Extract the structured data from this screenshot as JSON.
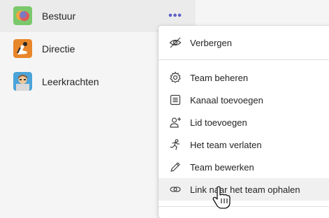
{
  "teams": [
    {
      "name": "Bestuur",
      "avatar_icon": "chat-bubbles-avatar-icon"
    },
    {
      "name": "Directie",
      "avatar_icon": "diver-avatar-icon"
    },
    {
      "name": "Leerkrachten",
      "avatar_icon": "teacher-avatar-icon"
    }
  ],
  "more_options_glyph": "•••",
  "context_menu": {
    "items": [
      {
        "label": "Verbergen",
        "icon": "eye-off-icon"
      },
      {
        "label": "Team beheren",
        "icon": "gear-icon"
      },
      {
        "label": "Kanaal toevoegen",
        "icon": "channel-add-icon"
      },
      {
        "label": "Lid toevoegen",
        "icon": "person-add-icon"
      },
      {
        "label": "Het team verlaten",
        "icon": "running-person-icon"
      },
      {
        "label": "Team bewerken",
        "icon": "pencil-icon"
      },
      {
        "label": "Link naar het team ophalen",
        "icon": "link-icon"
      }
    ]
  },
  "colors": {
    "accent": "#5b5fc7",
    "selected_row": "#ebebeb",
    "menu_hover": "#f0f0f0"
  }
}
